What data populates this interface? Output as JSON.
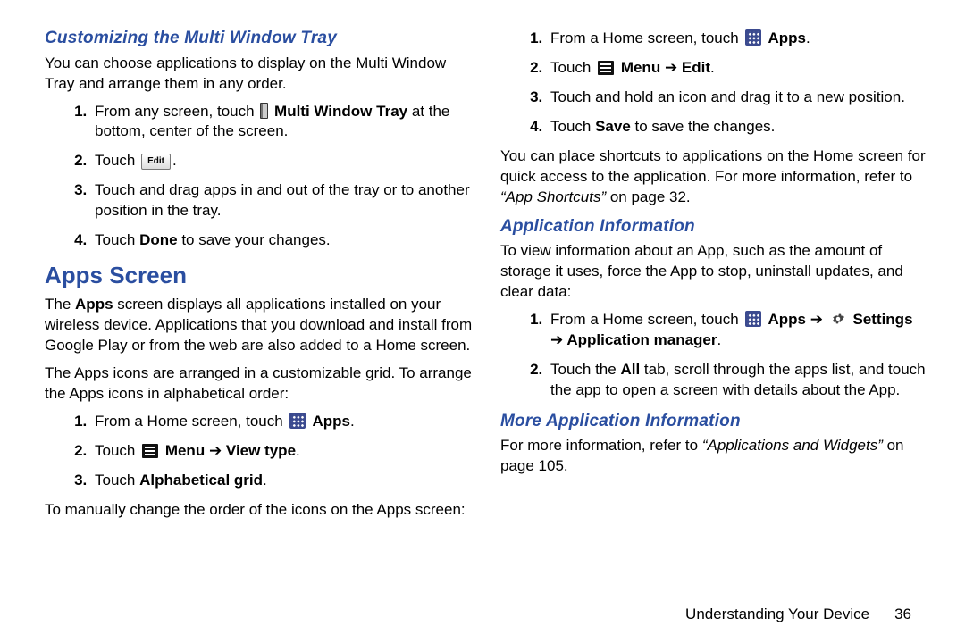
{
  "left": {
    "h3_customizing": "Customizing the Multi Window Tray",
    "p_customizing": "You can choose applications to display on the Multi Window Tray and arrange them in any order.",
    "steps_tray": {
      "s1_pre": "From any screen, touch ",
      "s1_post_bold": " Multi Window Tray",
      "s1_tail": " at the bottom, center of the screen.",
      "s2_pre": "Touch ",
      "s2_btn": "Edit",
      "s2_post": ".",
      "s3": "Touch and drag apps in and out of the tray or to another position in the tray.",
      "s4_pre": "Touch ",
      "s4_bold": "Done",
      "s4_post": " to save your changes."
    },
    "h2_apps": "Apps Screen",
    "p_apps1_a": "The ",
    "p_apps1_b": "Apps",
    "p_apps1_c": " screen displays all applications installed on your wireless device. Applications that you download and install from Google Play or from the web are also added to a Home screen.",
    "p_apps2": "The Apps icons are arranged in a customizable grid. To arrange the Apps icons in alphabetical order:",
    "steps_alpha": {
      "s1_pre": "From a Home screen, touch ",
      "s1_bold": " Apps",
      "s1_post": ".",
      "s2_pre": "Touch ",
      "s2_bold": " Menu ",
      "s2_arrow": "➔",
      "s2_bold2": " View type",
      "s2_post": ".",
      "s3_pre": "Touch ",
      "s3_bold": "Alphabetical grid",
      "s3_post": "."
    },
    "p_manual": "To manually change the order of the icons on the Apps screen:"
  },
  "right": {
    "steps_manual": {
      "s1_pre": "From a Home screen, touch ",
      "s1_bold": " Apps",
      "s1_post": ".",
      "s2_pre": "Touch ",
      "s2_bold": " Menu ",
      "s2_arrow": "➔",
      "s2_bold2": " Edit",
      "s2_post": ".",
      "s3": "Touch and hold an icon and drag it to a new position.",
      "s4_pre": "Touch ",
      "s4_bold": "Save",
      "s4_post": " to save the changes."
    },
    "p_shortcuts_a": "You can place shortcuts to applications on the Home screen for quick access to the application. For more information, refer to ",
    "p_shortcuts_i": "“App Shortcuts”",
    "p_shortcuts_b": " on page 32.",
    "h3_appinfo": "Application Information",
    "p_appinfo": "To view information about an App, such as the amount of storage it uses, force the App to stop, uninstall updates, and clear data:",
    "steps_info": {
      "s1_pre": "From a Home screen, touch ",
      "s1_bold": " Apps ",
      "s1_arrow": "➔",
      "s1_bold2": " Settings ",
      "s1_arrow2": "➔",
      "s1_bold3": " Application manager",
      "s1_post": ".",
      "s2_a": "Touch the ",
      "s2_bold": "All",
      "s2_b": " tab, scroll through the apps list, and touch the app to open a screen with details about the App."
    },
    "h3_more": "More Application Information",
    "p_more_a": "For more information, refer to ",
    "p_more_i": "“Applications and Widgets”",
    "p_more_b": " on page 105."
  },
  "footer": {
    "section": "Understanding Your Device",
    "page": "36"
  }
}
